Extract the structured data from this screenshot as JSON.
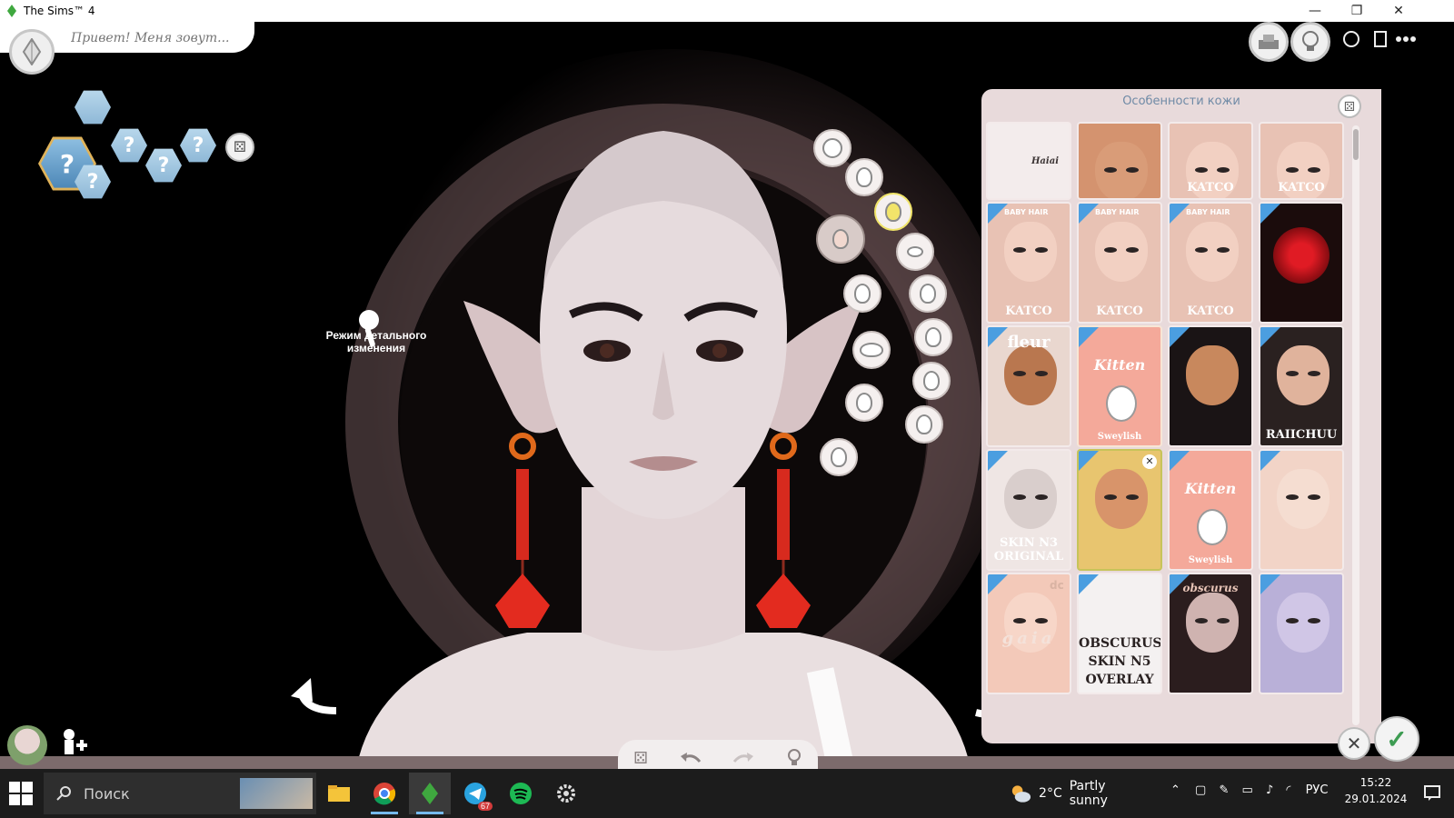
{
  "window": {
    "title": "The Sims™ 4",
    "minimize": "—",
    "restore": "❐",
    "close": "✕"
  },
  "cas": {
    "name_placeholder": "Привет! Меня зовут...",
    "genetics_unknown": "?",
    "detail_mode_label": "Режим детального изменения",
    "panel_title": "Особенности кожи",
    "dice": "⚄",
    "tiles": [
      {
        "row": 0,
        "col": 0,
        "label": "Haiai",
        "style": "sketch"
      },
      {
        "row": 0,
        "col": 1,
        "label": "",
        "style": "brow"
      },
      {
        "row": 0,
        "col": 2,
        "label": "KATCO",
        "style": "face-katco"
      },
      {
        "row": 0,
        "col": 3,
        "label": "KATCO",
        "style": "face-katco"
      },
      {
        "row": 1,
        "col": 0,
        "label": "KATCO",
        "top": "BABY HAIR",
        "style": "face-katco"
      },
      {
        "row": 1,
        "col": 1,
        "label": "KATCO",
        "top": "BABY HAIR",
        "style": "face-katco"
      },
      {
        "row": 1,
        "col": 2,
        "label": "KATCO",
        "top": "BABY HAIR",
        "style": "face-katco"
      },
      {
        "row": 1,
        "col": 3,
        "label": "",
        "style": "rose"
      },
      {
        "row": 2,
        "col": 0,
        "label": "fleur",
        "style": "fleur"
      },
      {
        "row": 2,
        "col": 1,
        "label": "Kitten",
        "bottom": "Sweylish",
        "style": "kitten"
      },
      {
        "row": 2,
        "col": 2,
        "label": "",
        "style": "hairline"
      },
      {
        "row": 2,
        "col": 3,
        "label": "RAIICHUU",
        "style": "raiichuu"
      },
      {
        "row": 3,
        "col": 0,
        "label": "SKIN N3 ORIGINAL",
        "style": "skin-original"
      },
      {
        "row": 3,
        "col": 1,
        "label": "",
        "style": "blonde"
      },
      {
        "row": 3,
        "col": 2,
        "label": "Kitten",
        "bottom": "Sweylish",
        "style": "kitten"
      },
      {
        "row": 3,
        "col": 3,
        "label": "",
        "style": "pale"
      },
      {
        "row": 4,
        "col": 0,
        "label": "gaia",
        "top": "dc",
        "style": "gaia"
      },
      {
        "row": 4,
        "col": 1,
        "label": "OBSCURUS SKIN N5 OVERLAY",
        "style": "obscurus"
      },
      {
        "row": 4,
        "col": 2,
        "label": "obscurus",
        "style": "obscurus-dark"
      },
      {
        "row": 4,
        "col": 3,
        "label": "",
        "style": "purple"
      }
    ]
  },
  "taskbar": {
    "search_label": "Поиск",
    "telegram_badge": "67",
    "weather_temp": "2°C",
    "weather_text": "Partly sunny",
    "language": "РУС",
    "time": "15:22",
    "date": "29.01.2024"
  },
  "colors": {
    "panel_bg": "#e8dadb",
    "accent_blue": "#4b9ee0",
    "hex_gold": "#e0b35a",
    "earring_red": "#d72a1e"
  }
}
